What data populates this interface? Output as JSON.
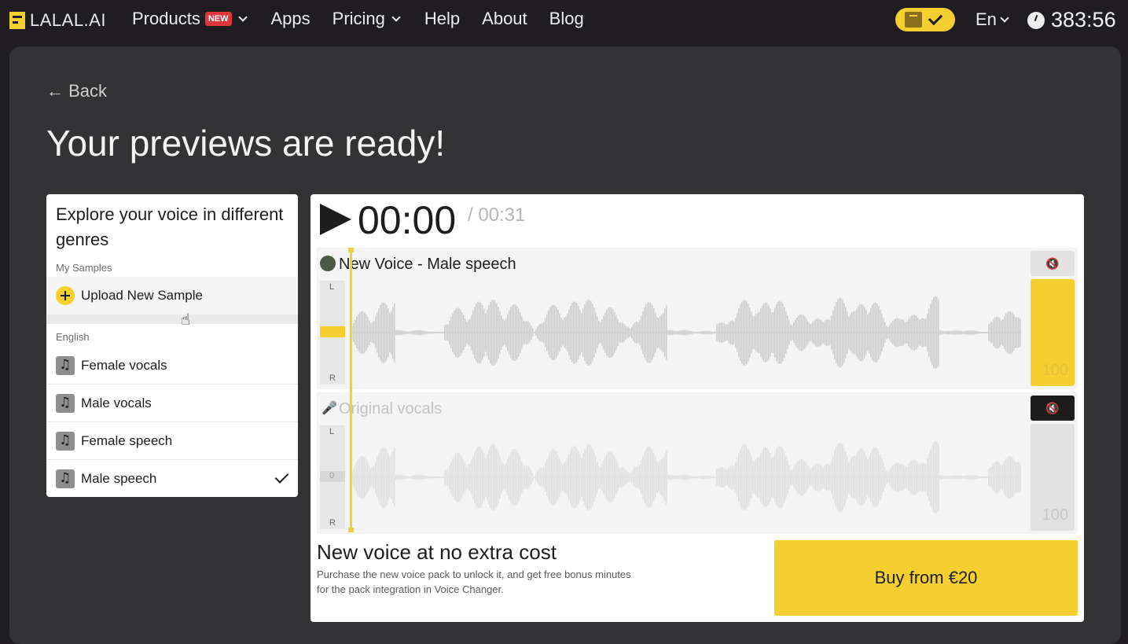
{
  "header": {
    "logo": "LALAL.AI",
    "nav": [
      {
        "label": "Products",
        "badge": "NEW",
        "dropdown": true
      },
      {
        "label": "Apps"
      },
      {
        "label": "Pricing",
        "dropdown": true
      },
      {
        "label": "Help"
      },
      {
        "label": "About"
      },
      {
        "label": "Blog"
      }
    ],
    "language": "En",
    "timer": "383:56"
  },
  "page": {
    "back_label": "← Back",
    "title": "Your previews are ready!"
  },
  "genres": {
    "heading": "Explore your voice in different genres",
    "my_samples_label": "My Samples",
    "upload_label": "Upload New Sample",
    "english_label": "English",
    "items": [
      {
        "label": "Female vocals",
        "selected": false
      },
      {
        "label": "Male vocals",
        "selected": false
      },
      {
        "label": "Female speech",
        "selected": false
      },
      {
        "label": "Male speech",
        "selected": true
      }
    ]
  },
  "player": {
    "current_time": "00:00",
    "total_time": "/ 00:31",
    "tracks": [
      {
        "name": "New Voice - Male speech",
        "balance_label": "",
        "volume": "100",
        "muted": false
      },
      {
        "name": "Original vocals",
        "balance_label": "0",
        "volume": "100",
        "muted": true
      }
    ],
    "lr_left": "L",
    "lr_right": "R",
    "mute_icon": "🔇"
  },
  "promo": {
    "title": "New voice at no extra cost",
    "subtitle": "Purchase the new voice pack to unlock it, and get free bonus minutes for the pack integration in Voice Changer.",
    "buy_label": "Buy from €20"
  },
  "colors": {
    "accent": "#f4cf2f",
    "background": "#1f1d21",
    "panel": "#333235"
  }
}
